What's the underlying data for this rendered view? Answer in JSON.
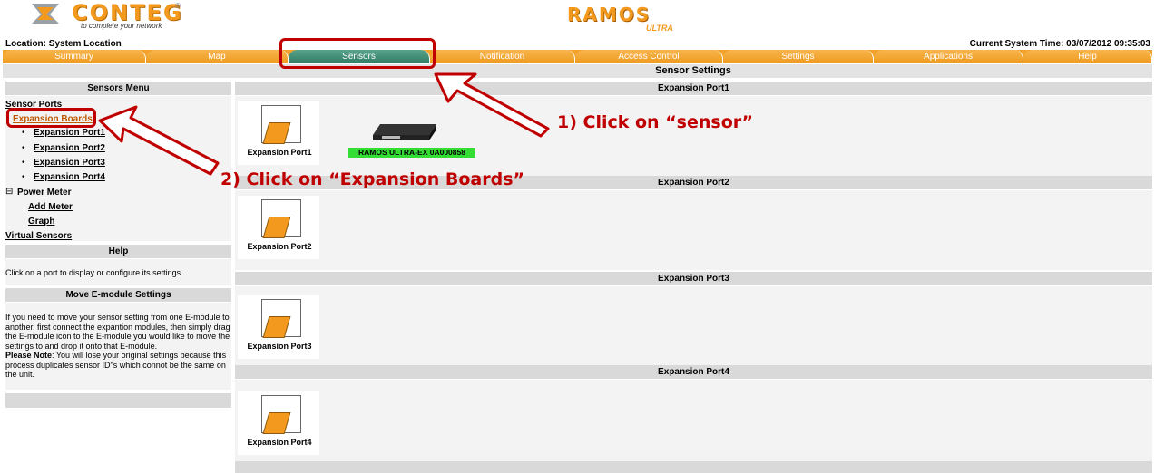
{
  "header": {
    "brand_name": "CONTEG",
    "brand_tagline": "to complete your network",
    "brand_reg": "®",
    "product_name": "RAMOS",
    "product_sub": "ULTRA",
    "location": "Location: System Location",
    "system_time": "Current System Time: 03/07/2012 09:35:03"
  },
  "tabs": [
    {
      "label": "Summary",
      "active": false
    },
    {
      "label": "Map",
      "active": false
    },
    {
      "label": "Sensors",
      "active": true
    },
    {
      "label": "Notification",
      "active": false
    },
    {
      "label": "Access Control",
      "active": false
    },
    {
      "label": "Settings",
      "active": false
    },
    {
      "label": "Applications",
      "active": false
    },
    {
      "label": "Help",
      "active": false
    }
  ],
  "page_title": "Sensor Settings",
  "sensors_menu": {
    "title": "Sensors Menu",
    "sensor_ports": "Sensor Ports",
    "expansion_boards": "Expansion Boards",
    "expansion_ports": [
      "Expansion Port1",
      "Expansion Port2",
      "Expansion Port3",
      "Expansion Port4"
    ],
    "power_meter": "Power Meter",
    "add_meter": "Add Meter",
    "graph": "Graph",
    "virtual_sensors": "Virtual Sensors"
  },
  "help_panel": {
    "title": "Help",
    "text": "Click on a port to display or configure its settings."
  },
  "move_panel": {
    "title": "Move E-module Settings",
    "text": "If you need to move your sensor setting from one E-module to another, first connect the expantion modules, then simply drag the E-module icon to the E-module you would like to move the settings to and drop it onto that E-module.",
    "note_label": "Please Note",
    "note_text": ": You will lose your original settings because this process duplicates sensor ID\"s which connot be the same on the unit."
  },
  "ports": [
    {
      "header": "Expansion Port1",
      "label": "Expansion Port1",
      "module": "RAMOS ULTRA-EX 0A000858"
    },
    {
      "header": "Expansion Port2",
      "label": "Expansion Port2"
    },
    {
      "header": "Expansion Port3",
      "label": "Expansion Port3"
    },
    {
      "header": "Expansion Port4",
      "label": "Expansion Port4"
    }
  ],
  "annotations": {
    "step1": "1) Click on “sensor”",
    "step2": "2) Click on “Expansion Boards”"
  },
  "colors": {
    "tab_orange": "#f3a22c",
    "tab_active_green": "#2f7c63",
    "annotation_red": "#c00000",
    "module_green": "#33dd33"
  }
}
